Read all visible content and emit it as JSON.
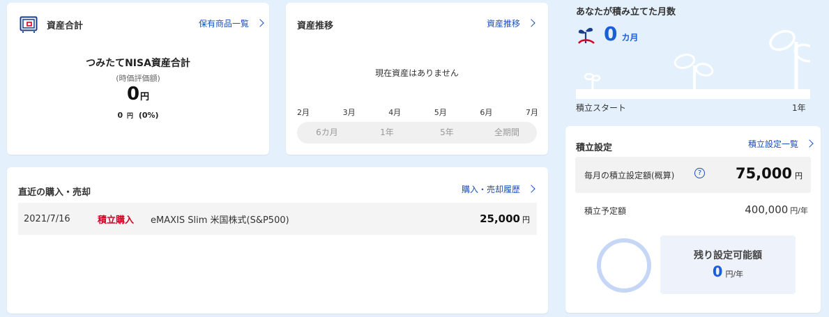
{
  "asset_total": {
    "title": "資産合計",
    "link": "保有商品一覧",
    "main_label": "つみたてNISA資産合計",
    "sub_label": "(時価評価額)",
    "value": "0",
    "value_unit": "円",
    "change_amount": "0",
    "change_unit": "円",
    "change_pct": "(0%)"
  },
  "asset_history": {
    "title": "資産推移",
    "link": "資産推移",
    "empty_message": "現在資産はありません",
    "months": [
      "2月",
      "3月",
      "4月",
      "5月",
      "6月",
      "7月"
    ],
    "periods": [
      "6カ月",
      "1年",
      "5年",
      "全期間"
    ]
  },
  "recent_transactions": {
    "title": "直近の購入・売却",
    "link": "購入・売却履歴",
    "rows": [
      {
        "date": "2021/7/16",
        "type": "積立購入",
        "fund": "eMAXIS Slim 米国株式(S&P500)",
        "amount": "25,000",
        "unit": "円"
      }
    ]
  },
  "months_accumulated": {
    "title": "あなたが積み立てた月数",
    "value": "0",
    "unit": "カ月",
    "start_label": "積立スタート",
    "end_label": "1年"
  },
  "settings": {
    "title": "積立設定",
    "link": "積立設定一覧",
    "monthly_label": "毎月の積立設定額(概算)",
    "monthly_value": "75,000",
    "monthly_unit": "円",
    "planned_label": "積立予定額",
    "planned_value": "400,000",
    "planned_unit": "円/年",
    "remaining_label": "残り設定可能額",
    "remaining_value": "0",
    "remaining_unit": "円/年"
  },
  "colors": {
    "accent_blue": "#1a5fd6",
    "link_blue": "#1a4fb8",
    "alert_red": "#d40024",
    "page_bg": "#e4f0fb"
  },
  "icons": {
    "asset_total": "wallet-icon",
    "link": "chevron-right-icon",
    "months": "sprout-icon",
    "help": "question-circle-icon"
  }
}
